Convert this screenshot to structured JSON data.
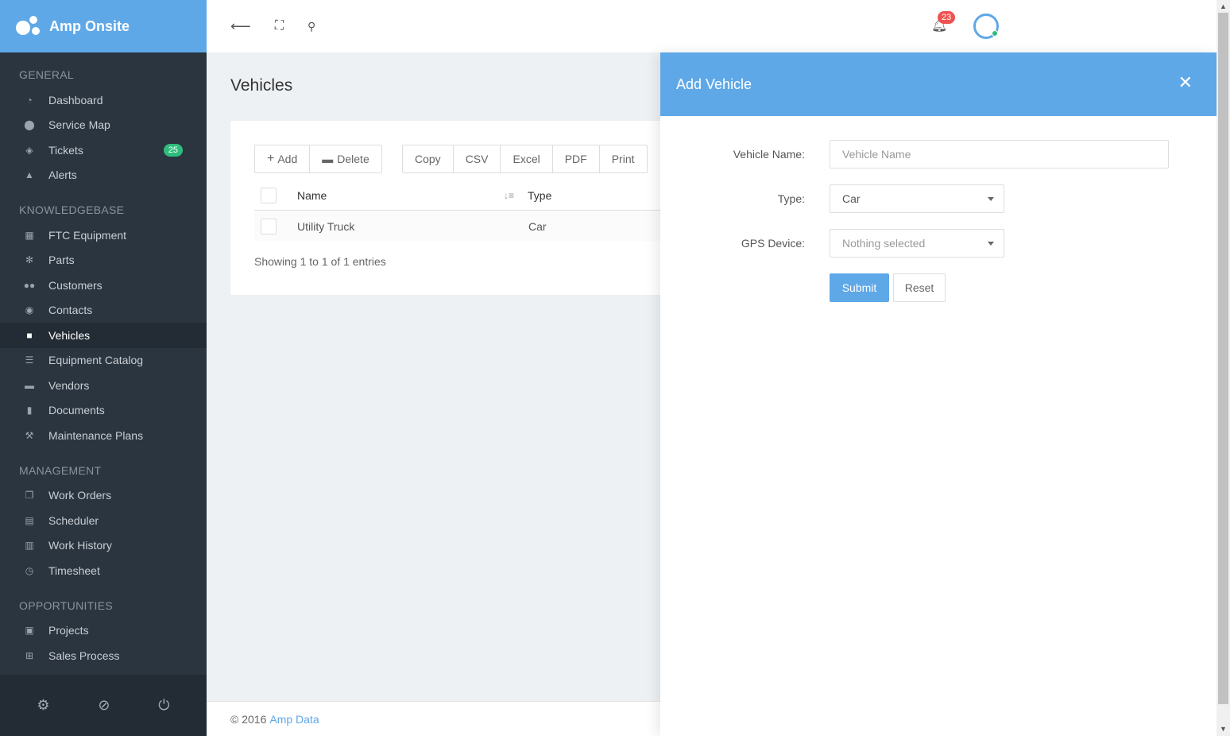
{
  "brand": {
    "name": "Amp Onsite"
  },
  "sidebar": {
    "sections": [
      {
        "title": "GENERAL",
        "items": [
          {
            "label": "Dashboard",
            "icon": "dashboard-icon"
          },
          {
            "label": "Service Map",
            "icon": "map-marker-icon"
          },
          {
            "label": "Tickets",
            "icon": "tag-icon",
            "badge": "25"
          },
          {
            "label": "Alerts",
            "icon": "warning-icon"
          }
        ]
      },
      {
        "title": "KNOWLEDGEBASE",
        "items": [
          {
            "label": "FTC Equipment",
            "icon": "building-icon"
          },
          {
            "label": "Parts",
            "icon": "cogs-icon"
          },
          {
            "label": "Customers",
            "icon": "users-icon"
          },
          {
            "label": "Contacts",
            "icon": "user-circle-icon"
          },
          {
            "label": "Vehicles",
            "icon": "truck-icon"
          },
          {
            "label": "Equipment Catalog",
            "icon": "list-icon"
          },
          {
            "label": "Vendors",
            "icon": "cart-icon"
          },
          {
            "label": "Documents",
            "icon": "file-icon"
          },
          {
            "label": "Maintenance Plans",
            "icon": "wrench-icon"
          }
        ]
      },
      {
        "title": "MANAGEMENT",
        "items": [
          {
            "label": "Work Orders",
            "icon": "copy-icon"
          },
          {
            "label": "Scheduler",
            "icon": "calendar-icon"
          },
          {
            "label": "Work History",
            "icon": "calendar-check-icon"
          },
          {
            "label": "Timesheet",
            "icon": "clock-icon"
          }
        ]
      },
      {
        "title": "OPPORTUNITIES",
        "items": [
          {
            "label": "Projects",
            "icon": "clipboard-icon"
          },
          {
            "label": "Sales Process",
            "icon": "sitemap-icon"
          }
        ]
      }
    ]
  },
  "topbar": {
    "notifications_count": "23"
  },
  "page": {
    "title": "Vehicles"
  },
  "toolbar": {
    "add_label": "Add",
    "delete_label": "Delete",
    "export_buttons": [
      "Copy",
      "CSV",
      "Excel",
      "PDF",
      "Print"
    ]
  },
  "table": {
    "columns": [
      "Name",
      "Type"
    ],
    "rows": [
      [
        "Utility Truck",
        "Car"
      ]
    ],
    "info": "Showing 1 to 1 of 1 entries"
  },
  "footer": {
    "copyright": "© 2016",
    "link": "Amp Data"
  },
  "modal": {
    "title": "Add Vehicle",
    "fields": {
      "vehicle_name_label": "Vehicle Name:",
      "vehicle_name_placeholder": "Vehicle Name",
      "type_label": "Type:",
      "type_value": "Car",
      "gps_label": "GPS Device:",
      "gps_value": "Nothing selected"
    },
    "submit_label": "Submit",
    "reset_label": "Reset"
  },
  "colors": {
    "accent": "#5fa8e8",
    "sidebar": "#2b3540",
    "badge_green": "#2ebd7d",
    "badge_red": "#ef5350"
  }
}
